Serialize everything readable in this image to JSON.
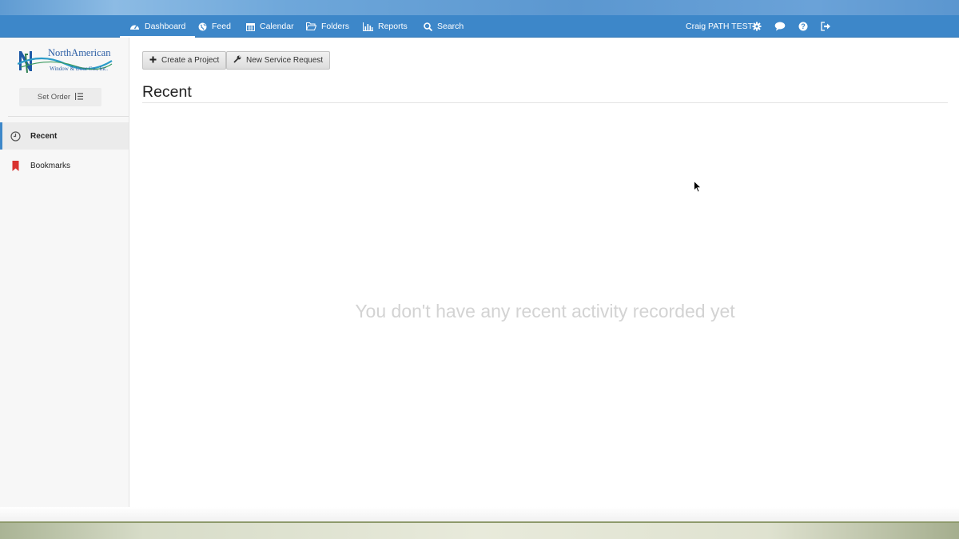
{
  "nav": {
    "items": [
      {
        "label": "Dashboard",
        "icon": "dashboard-icon",
        "active": true
      },
      {
        "label": "Feed",
        "icon": "globe-icon"
      },
      {
        "label": "Calendar",
        "icon": "calendar-icon"
      },
      {
        "label": "Folders",
        "icon": "folder-icon"
      },
      {
        "label": "Reports",
        "icon": "bar-chart-icon"
      },
      {
        "label": "Search",
        "icon": "search-icon"
      }
    ],
    "user": "Craig PATH TEST",
    "right_icons": [
      "gear-icon",
      "chat-bubble-icon",
      "help-icon",
      "logout-icon"
    ]
  },
  "logo": {
    "letter": "N",
    "name": "NorthAmerican",
    "sub": "Window & Door Co., Inc."
  },
  "sidebar": {
    "set_order_label": "Set Order",
    "items": [
      {
        "label": "Recent",
        "icon": "clock-icon",
        "active": true
      },
      {
        "label": "Bookmarks",
        "icon": "bookmark-icon"
      }
    ]
  },
  "toolbar": {
    "create_project_label": "Create a Project",
    "new_service_request_label": "New Service Request"
  },
  "main": {
    "title": "Recent",
    "empty_message": "You don't have any recent activity recorded yet"
  },
  "colors": {
    "nav_bg": "#3d87c9",
    "bookmark_red": "#d9322f",
    "brand_blue": "#1f5aa6"
  }
}
